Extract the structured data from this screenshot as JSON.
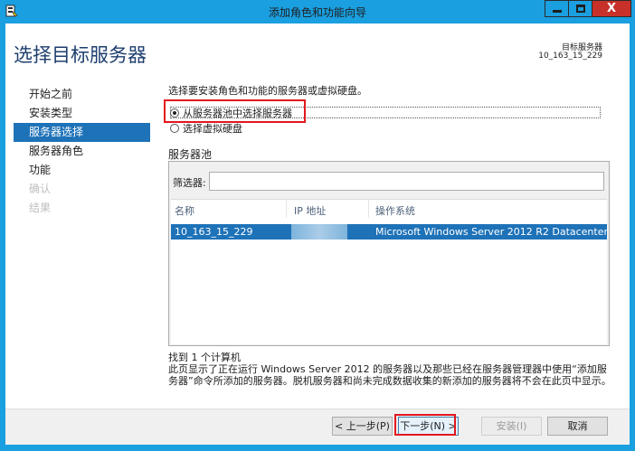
{
  "window": {
    "title": "添加角色和功能向导",
    "close_glyph": "X"
  },
  "header": {
    "title": "选择目标服务器",
    "dest_label": "目标服务器",
    "dest_value": "10_163_15_229"
  },
  "nav": {
    "items": [
      {
        "label": "开始之前"
      },
      {
        "label": "安装类型"
      },
      {
        "label": "服务器选择"
      },
      {
        "label": "服务器角色"
      },
      {
        "label": "功能"
      },
      {
        "label": "确认"
      },
      {
        "label": "结果"
      }
    ]
  },
  "content": {
    "description": "选择要安装角色和功能的服务器或虚拟硬盘。",
    "radio_pool": "从服务器池中选择服务器",
    "radio_vhd": "选择虚拟硬盘",
    "pool_label": "服务器池",
    "filter_label": "筛选器:",
    "filter_value": "",
    "columns": {
      "name": "名称",
      "ip": "IP 地址",
      "os": "操作系统"
    },
    "rows": [
      {
        "name": "10_163_15_229",
        "ip": "",
        "os": "Microsoft Windows Server 2012 R2 Datacenter"
      }
    ],
    "found": "找到 1 个计算机",
    "note": "此页显示了正在运行 Windows Server 2012 的服务器以及那些已经在服务器管理器中使用“添加服务器”命令所添加的服务器。脱机服务器和尚未完成数据收集的新添加的服务器将不会在此页中显示。"
  },
  "buttons": {
    "prev": "< 上一步(P)",
    "next": "下一步(N) >",
    "install": "安装(I)",
    "cancel": "取消"
  },
  "colors": {
    "titlebar": "#1a9fe0",
    "selection": "#1e72b8",
    "annotation": "#e2171e"
  }
}
